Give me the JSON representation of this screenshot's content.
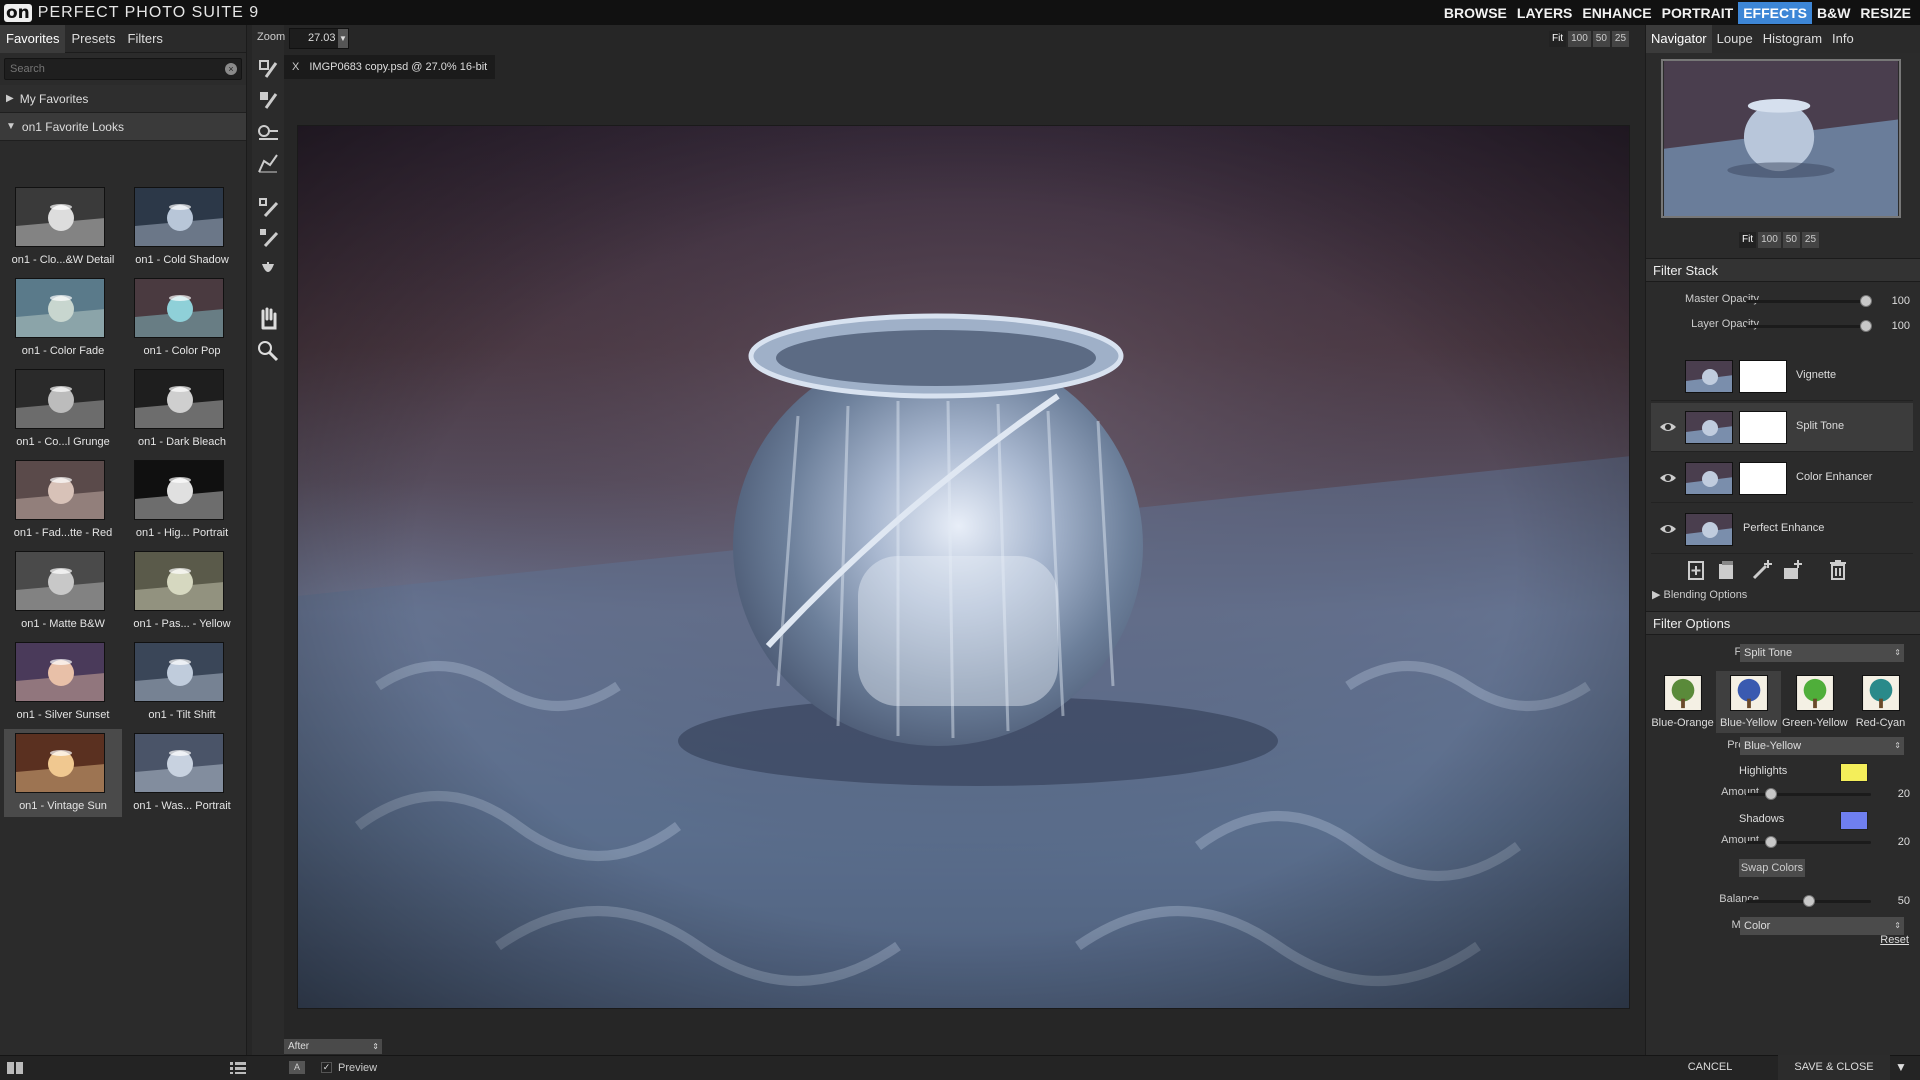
{
  "app": {
    "logo": "on",
    "title": "PERFECT PHOTO SUITE 9"
  },
  "main_nav": [
    {
      "label": "BROWSE",
      "active": false
    },
    {
      "label": "LAYERS",
      "active": false
    },
    {
      "label": "ENHANCE",
      "active": false
    },
    {
      "label": "PORTRAIT",
      "active": false
    },
    {
      "label": "EFFECTS",
      "active": true
    },
    {
      "label": "B&W",
      "active": false
    },
    {
      "label": "RESIZE",
      "active": false
    }
  ],
  "left_panel": {
    "tabs": [
      "Favorites",
      "Presets",
      "Filters"
    ],
    "search_placeholder": "Search",
    "sections": {
      "my_favorites": "My Favorites",
      "favorite_looks": "on1 Favorite Looks"
    },
    "looks": [
      {
        "label": "on1 - Clo...&W Detail",
        "tone": "bw"
      },
      {
        "label": "on1 - Cold Shadow",
        "tone": "cold"
      },
      {
        "label": "on1 - Color Fade",
        "tone": "fade"
      },
      {
        "label": "on1 - Color Pop",
        "tone": "pop"
      },
      {
        "label": "on1 - Co...l Grunge",
        "tone": "grunge"
      },
      {
        "label": "on1 - Dark Bleach",
        "tone": "bleach"
      },
      {
        "label": "on1 - Fad...tte - Red",
        "tone": "red"
      },
      {
        "label": "on1 - Hig... Portrait",
        "tone": "highbw"
      },
      {
        "label": "on1 - Matte B&W",
        "tone": "matte"
      },
      {
        "label": "on1 - Pas... - Yellow",
        "tone": "yellow"
      },
      {
        "label": "on1 - Silver Sunset",
        "tone": "sunset"
      },
      {
        "label": "on1 - Tilt Shift",
        "tone": "tilt"
      },
      {
        "label": "on1 - Vintage Sun",
        "tone": "vintage",
        "selected": true
      },
      {
        "label": "on1 - Was... Portrait",
        "tone": "washed"
      }
    ]
  },
  "toolbar": {
    "zoom_label": "Zoom",
    "zoom_value": "27.03",
    "tools": [
      "quick-mask-brush-icon",
      "masking-brush-icon",
      "masking-bug-icon",
      "chisel-icon",
      "retouch-brush-icon",
      "perfect-eraser-icon",
      "blur-brush-icon",
      "hand-icon",
      "zoom-icon"
    ]
  },
  "document": {
    "tab_close": "X",
    "tab_title": "IMGP0683 copy.psd @ 27.0% 16-bit"
  },
  "view_buttons": [
    "Fit",
    "100",
    "50",
    "25"
  ],
  "bottom": {
    "compare_mode": "After",
    "a_label": "A",
    "preview_check": "✓",
    "preview_label": "Preview"
  },
  "right_panel": {
    "tabs": [
      "Navigator",
      "Loupe",
      "Histogram",
      "Info"
    ],
    "nav_buttons": [
      "Fit",
      "100",
      "50",
      "25"
    ],
    "filter_stack": {
      "title": "Filter Stack",
      "master_opacity": {
        "label": "Master Opacity",
        "value": 100
      },
      "layer_opacity": {
        "label": "Layer Opacity",
        "value": 100
      },
      "layers": [
        {
          "name": "Vignette",
          "visible": false,
          "has_mask": true,
          "selected": false
        },
        {
          "name": "Split Tone",
          "visible": true,
          "has_mask": true,
          "selected": true
        },
        {
          "name": "Color Enhancer",
          "visible": true,
          "has_mask": true,
          "selected": false
        },
        {
          "name": "Perfect Enhance",
          "visible": true,
          "has_mask": false,
          "selected": false
        }
      ],
      "blending_options": "Blending Options"
    },
    "filter_options": {
      "title": "Filter Options",
      "filter_label": "Filter",
      "filter_value": "Split Tone",
      "presets": [
        {
          "label": "Blue-Orange",
          "color": "#5a8a3a",
          "selected": false
        },
        {
          "label": "Blue-Yellow",
          "color": "#3a5ab0",
          "selected": true
        },
        {
          "label": "Green-Yellow",
          "color": "#4fae3a",
          "selected": false
        },
        {
          "label": "Red-Cyan",
          "color": "#2a8a8a",
          "selected": false
        }
      ],
      "preset_label": "Preset",
      "preset_value": "Blue-Yellow",
      "highlights_label": "Highlights",
      "highlights_color": "#f4ee5a",
      "highlights_amount": {
        "label": "Amount",
        "value": 20
      },
      "shadows_label": "Shadows",
      "shadows_color": "#6f7ff0",
      "shadows_amount": {
        "label": "Amount",
        "value": 20
      },
      "swap_colors": "Swap Colors",
      "balance": {
        "label": "Balance",
        "value": 50
      },
      "mode_label": "Mode",
      "mode_value": "Color",
      "reset": "Reset"
    },
    "cancel": "CANCEL",
    "save_close": "SAVE & CLOSE"
  },
  "colors": {
    "accent": "#3d86d6"
  }
}
